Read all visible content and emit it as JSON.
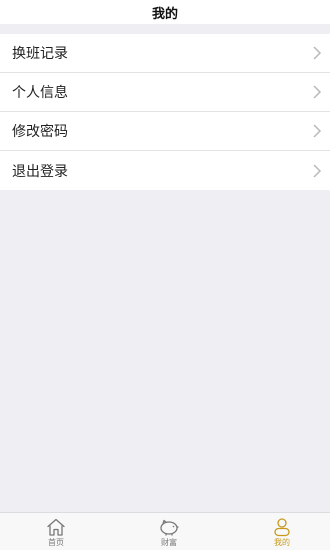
{
  "header": {
    "title": "我的"
  },
  "menu": {
    "items": [
      {
        "label": "换班记录"
      },
      {
        "label": "个人信息"
      },
      {
        "label": "修改密码"
      },
      {
        "label": "退出登录"
      }
    ]
  },
  "tabbar": {
    "tabs": [
      {
        "label": "首页",
        "icon": "home-icon",
        "active": false
      },
      {
        "label": "财富",
        "icon": "piggy-bank-icon",
        "active": false
      },
      {
        "label": "我的",
        "icon": "user-icon",
        "active": true
      }
    ],
    "active_color": "#c79a1c",
    "inactive_color": "#777777"
  }
}
